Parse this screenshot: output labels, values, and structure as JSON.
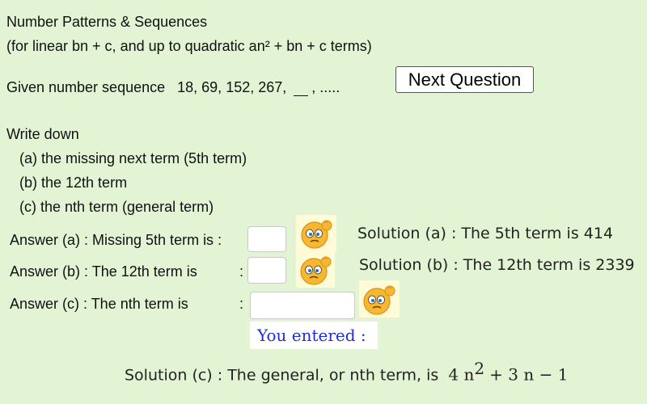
{
  "header": {
    "title": "Number Patterns & Sequences",
    "subtitle": "(for linear bn + c, and up to quadratic an² + bn + c terms)"
  },
  "question": {
    "given_label": "Given number sequence",
    "sequence": "18, 69, 152, 267,",
    "ellipsis": ", .....",
    "next_button": "Next Question"
  },
  "instructions": {
    "intro": "Write down",
    "items": [
      "(a)  the missing next term (5th term)",
      "(b)  the 12th term",
      "(c)  the nth term (general term)"
    ]
  },
  "answers": {
    "a_label": "Answer (a) : Missing 5th term is :",
    "b_label": "Answer (b) : The 12th term is",
    "b_colon": ":",
    "c_label": "Answer (c) :  The nth term is",
    "c_colon": ":",
    "a_value": "",
    "b_value": "",
    "c_value": ""
  },
  "solutions": {
    "a": "Solution (a) : The 5th term is 414",
    "b": "Solution (b) : The 12th term is 2339",
    "c_prefix": "Solution (c) : The general, or nth term, is",
    "c_coef_a": "4 n",
    "c_exp": "2",
    "c_rest": "+ 3 n − 1"
  },
  "feedback": {
    "you_entered": "You entered :"
  },
  "icons": {
    "status": "thinking-emoji-icon"
  },
  "colors": {
    "background": "#e2f4d4",
    "you_entered_text": "#1f2fd6"
  }
}
